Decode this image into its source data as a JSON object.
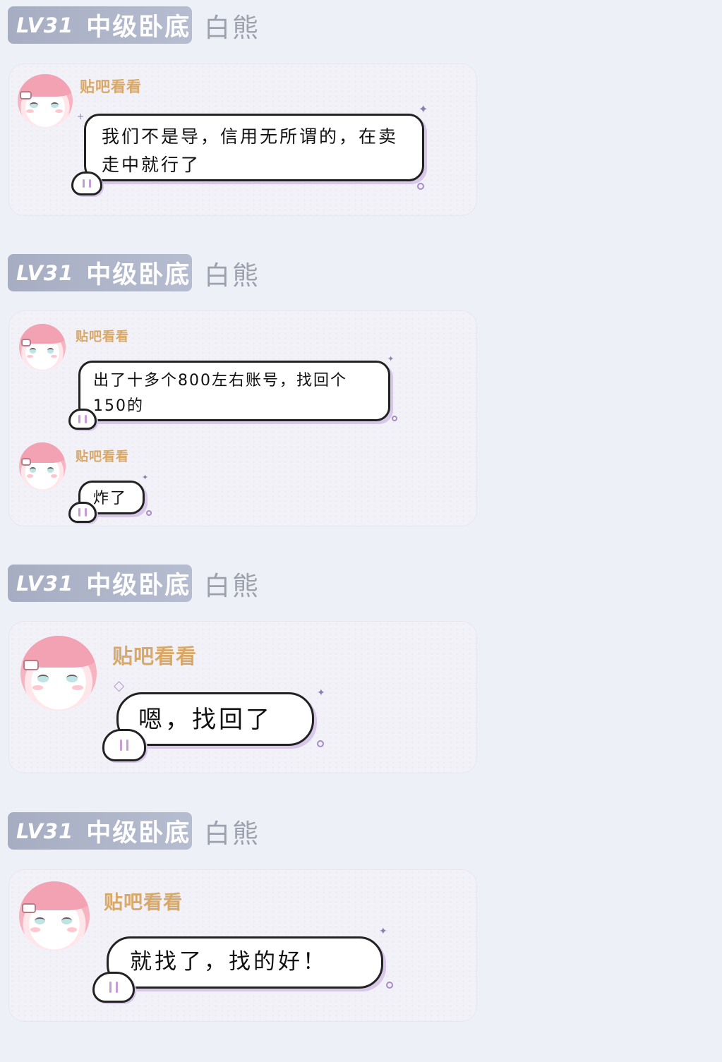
{
  "posts": [
    {
      "level": "LV31",
      "rank": "中级卧底",
      "username": "白熊",
      "messages": [
        {
          "sender": "贴吧看看",
          "text": "我们不是导，信用无所谓的，在卖走中就行了"
        }
      ]
    },
    {
      "level": "LV31",
      "rank": "中级卧底",
      "username": "白熊",
      "messages": [
        {
          "sender": "贴吧看看",
          "text": "出了十多个800左右账号，找回个150的"
        },
        {
          "sender": "贴吧看看",
          "text": "炸了"
        }
      ]
    },
    {
      "level": "LV31",
      "rank": "中级卧底",
      "username": "白熊",
      "messages": [
        {
          "sender": "贴吧看看",
          "text": "嗯，找回了"
        }
      ]
    },
    {
      "level": "LV31",
      "rank": "中级卧底",
      "username": "白熊",
      "messages": [
        {
          "sender": "贴吧看看",
          "text": "就找了，找的好！"
        }
      ]
    }
  ]
}
